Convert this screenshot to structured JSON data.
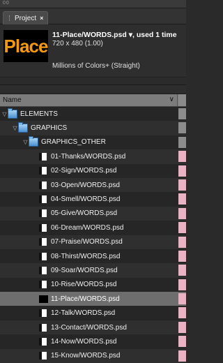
{
  "window": {
    "title_dots": "00"
  },
  "tab": {
    "label": "Project",
    "close": "×"
  },
  "preview": {
    "thumb_text": "Place",
    "filename": "11-Place/WORDS.psd",
    "used": "▾, used 1 time",
    "dims": "720 x 480 (1.00)",
    "colors": "Millions of Colors+ (Straight)"
  },
  "columns": {
    "name": "Name",
    "chevron": "∨"
  },
  "items": [
    {
      "label": "ELEMENTS",
      "type": "folder",
      "depth": 0,
      "tag": "gray"
    },
    {
      "label": "GRAPHICS",
      "type": "folder",
      "depth": 1,
      "tag": "gray"
    },
    {
      "label": "GRAPHICS_OTHER",
      "type": "folder",
      "depth": 2,
      "tag": "gray"
    },
    {
      "label": "01-Thanks/WORDS.psd",
      "type": "psd",
      "depth": 3,
      "tag": "pink"
    },
    {
      "label": "02-Sign/WORDS.psd",
      "type": "psd",
      "depth": 3,
      "tag": "pink"
    },
    {
      "label": "03-Open/WORDS.psd",
      "type": "psd",
      "depth": 3,
      "tag": "pink"
    },
    {
      "label": "04-Smell/WORDS.psd",
      "type": "psd",
      "depth": 3,
      "tag": "pink"
    },
    {
      "label": "05-Give/WORDS.psd",
      "type": "psd",
      "depth": 3,
      "tag": "pink"
    },
    {
      "label": "06-Dream/WORDS.psd",
      "type": "psd",
      "depth": 3,
      "tag": "pink"
    },
    {
      "label": "07-Praise/WORDS.psd",
      "type": "psd",
      "depth": 3,
      "tag": "pink"
    },
    {
      "label": "08-Thirst/WORDS.psd",
      "type": "psd",
      "depth": 3,
      "tag": "pink"
    },
    {
      "label": "09-Soar/WORDS.psd",
      "type": "psd",
      "depth": 3,
      "tag": "pink"
    },
    {
      "label": "10-Rise/WORDS.psd",
      "type": "psd",
      "depth": 3,
      "tag": "pink"
    },
    {
      "label": "11-Place/WORDS.psd",
      "type": "psd-selected",
      "depth": 3,
      "tag": "pink"
    },
    {
      "label": "12-Talk/WORDS.psd",
      "type": "psd",
      "depth": 3,
      "tag": "pink"
    },
    {
      "label": "13-Contact/WORDS.psd",
      "type": "psd",
      "depth": 3,
      "tag": "pink"
    },
    {
      "label": "14-Now/WORDS.psd",
      "type": "psd",
      "depth": 3,
      "tag": "pink"
    },
    {
      "label": "15-Know/WORDS.psd",
      "type": "psd",
      "depth": 3,
      "tag": "pink"
    }
  ]
}
